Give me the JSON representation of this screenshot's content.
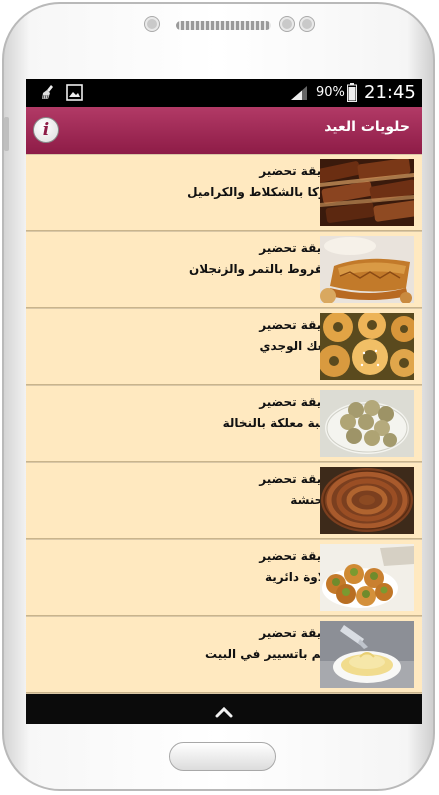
{
  "statusbar": {
    "battery_percent": "90%",
    "time": "21:45",
    "icons": [
      "broom-icon",
      "image-icon",
      "signal-icon",
      "battery-icon"
    ]
  },
  "appbar": {
    "title": "حلويات العيد",
    "info_icon": "i",
    "color": "#9b2350"
  },
  "list": {
    "items": [
      {
        "label": "طريقة تحضير",
        "title": "النوكا بالشكلاط والكراميل",
        "image": "chocolate-caramel-bars"
      },
      {
        "label": "طريقة تحضير",
        "title": "المقروط بالتمر والزنجلان",
        "image": "makrout-pastry"
      },
      {
        "label": "طريقة تحضير",
        "title": "الكعك الوجدي",
        "image": "ring-cookies"
      },
      {
        "label": "طريقة تحضير",
        "title": "غريبة معلكة بالنخالة",
        "image": "ghriba-cookies"
      },
      {
        "label": "طريقة تحضير",
        "title": "المحنشة",
        "image": "coiled-pastry"
      },
      {
        "label": "طريقة تحضير",
        "title": "بحلاوة دائرية",
        "image": "round-baklava"
      },
      {
        "label": "طريقة تحضير",
        "title": "كريم باتسيير في البيت",
        "image": "pastry-cream"
      }
    ]
  },
  "navbar": {
    "icon": "chevron-up-icon"
  },
  "colors": {
    "row_background": "#ffe9c0",
    "appbar": "#9b2350",
    "statusbar": "#000000"
  }
}
